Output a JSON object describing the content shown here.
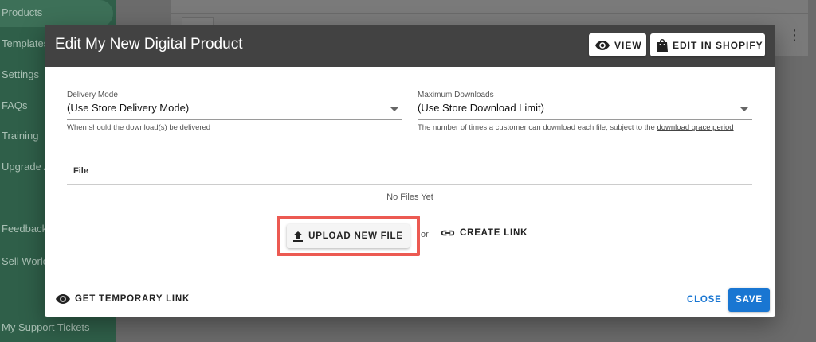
{
  "sidebar": {
    "items": [
      {
        "label": "Products"
      },
      {
        "label": "Templates"
      },
      {
        "label": "Settings"
      },
      {
        "label": "FAQs"
      },
      {
        "label": "Training"
      },
      {
        "label": "Upgrade A"
      },
      {
        "label": "Feedback"
      },
      {
        "label": "Sell World"
      },
      {
        "label": "My Support Tickets"
      }
    ]
  },
  "dialog": {
    "title": "Edit My New Digital Product",
    "view_label": "VIEW",
    "edit_shopify_label": "EDIT IN SHOPIFY",
    "delivery_mode": {
      "label": "Delivery Mode",
      "value": "(Use Store Delivery Mode)",
      "hint": "When should the download(s) be delivered"
    },
    "max_downloads": {
      "label": "Maximum Downloads",
      "value": "(Use Store Download Limit)",
      "hint": "The number of times a customer can download each file, subject to the",
      "hint_link": "download grace period"
    },
    "files": {
      "column_header": "File",
      "empty_text": "No Files Yet",
      "upload_label": "UPLOAD NEW FILE",
      "or_text": "or",
      "create_link_label": "CREATE LINK"
    },
    "footer": {
      "temp_link_label": "GET TEMPORARY LINK",
      "close_label": "CLOSE",
      "save_label": "SAVE"
    }
  },
  "colors": {
    "header_bg": "#424242",
    "primary": "#1976d2",
    "highlight": "#ec5a52",
    "sidebar_bg": "#2f5f49"
  },
  "icons": {
    "view": "eye-icon",
    "shopify": "shopping-bag-icon",
    "upload": "upload-icon",
    "link": "link-icon",
    "temp_link": "eye-icon",
    "more": "kebab-menu-icon"
  }
}
